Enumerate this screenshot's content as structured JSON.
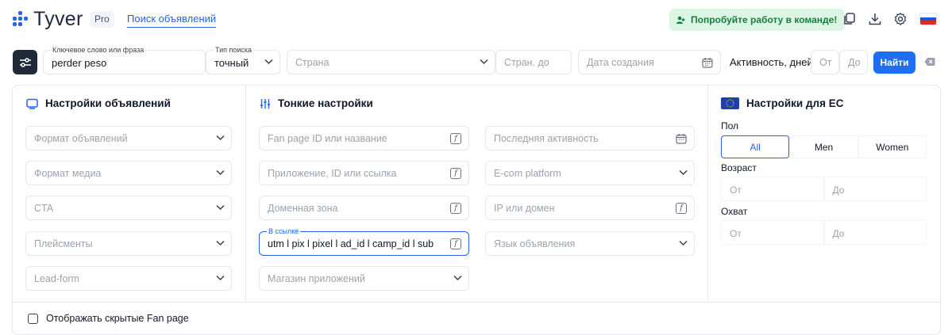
{
  "header": {
    "brand": "Tyver",
    "badge": "Pro",
    "nav_link": "Поиск объявлений",
    "team_button": "Попробуйте работу в команде!",
    "icons": [
      "copy-icon",
      "download-icon",
      "settings-icon",
      "flag-ru-icon"
    ]
  },
  "search": {
    "keyword_label": "Ключевое слово или фраза",
    "keyword_value": "perder peso",
    "type_label": "Тип поиска",
    "type_value": "точный",
    "country_placeholder": "Страна",
    "country_to_placeholder": "Стран. до",
    "date_placeholder": "Дата создания",
    "activity_label": "Активность, дней",
    "from_placeholder": "От",
    "to_placeholder": "До",
    "find_button": "Найти"
  },
  "ad_settings": {
    "title": "Настройки объявлений",
    "fields": [
      "Формат объявлений",
      "Формат медиа",
      "CTA",
      "Плейсменты",
      "Lead-form"
    ]
  },
  "fine_settings": {
    "title": "Тонкие настройки",
    "left": [
      {
        "placeholder": "Fan page ID или название"
      },
      {
        "placeholder": "Приложение, ID или ссылка"
      },
      {
        "placeholder": "Доменная зона"
      },
      {
        "label": "В ссылке",
        "value": "utm l pix l pixel l ad_id l camp_id l sub"
      },
      {
        "placeholder": "Магазин приложений"
      }
    ],
    "right": [
      "Последняя активность",
      "E-com platform",
      "IP или домен",
      "Язык объявления"
    ]
  },
  "eu_settings": {
    "title": "Настройки для ЕС",
    "gender_label": "Пол",
    "gender_options": [
      "All",
      "Men",
      "Women"
    ],
    "gender_selected": "All",
    "age_label": "Возраст",
    "reach_label": "Охват",
    "from": "От",
    "to": "До"
  },
  "footer": {
    "show_hidden": "Отображать скрытые Fan page"
  },
  "colors": {
    "accent": "#2563eb",
    "button": "#1d6ef5",
    "team_bg": "#dcf5e4",
    "team_text": "#15803d"
  }
}
